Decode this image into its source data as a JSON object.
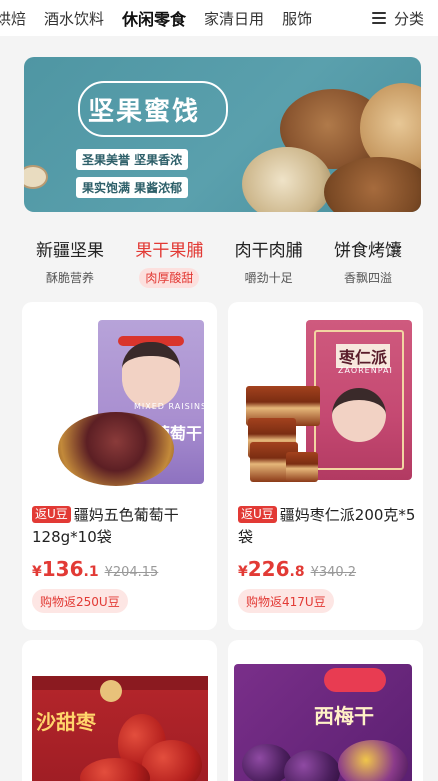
{
  "topnav": {
    "tabs": [
      "烘焙",
      "酒水饮料",
      "休闲零食",
      "家清日用",
      "服饰"
    ],
    "active_index": 2,
    "more_label": "分类",
    "more_icon": "menu-icon"
  },
  "banner": {
    "title": "坚果蜜饯",
    "tag_1": "圣果美誉  坚果香浓",
    "tag_2": "果实饱满  果酱浓郁"
  },
  "subtabs": [
    {
      "name": "新疆坚果",
      "desc": "酥脆营养"
    },
    {
      "name": "果干果脯",
      "desc": "肉厚酸甜"
    },
    {
      "name": "肉干肉脯",
      "desc": "嚼劲十足"
    },
    {
      "name": "饼食烤馕",
      "desc": "香飘四溢"
    }
  ],
  "subtabs_active_index": 1,
  "products": [
    {
      "badge": "返U豆",
      "title": "疆妈五色葡萄干128g*10袋",
      "currency": "¥",
      "price_int": "136",
      "price_dec": ".1",
      "original_price": "¥204.15",
      "cashback": "购物返250U豆",
      "image": {
        "package_label": "葡萄干",
        "package_en": "MIXED RAISINS"
      }
    },
    {
      "badge": "返U豆",
      "title": "疆妈枣仁派200克*5袋",
      "currency": "¥",
      "price_int": "226",
      "price_dec": ".8",
      "original_price": "¥340.2",
      "cashback": "购物返417U豆",
      "image": {
        "package_label": "枣仁派",
        "package_en": "ZAORENPAI"
      }
    },
    {
      "image": {
        "package_label": "沙甜枣"
      }
    },
    {
      "image": {
        "package_label": "西梅干"
      }
    }
  ],
  "colors": {
    "accent": "#e23a35",
    "accent_light": "#fde6e4",
    "banner_bg": "#5aa0ad",
    "page_bg": "#f4f4f4"
  }
}
